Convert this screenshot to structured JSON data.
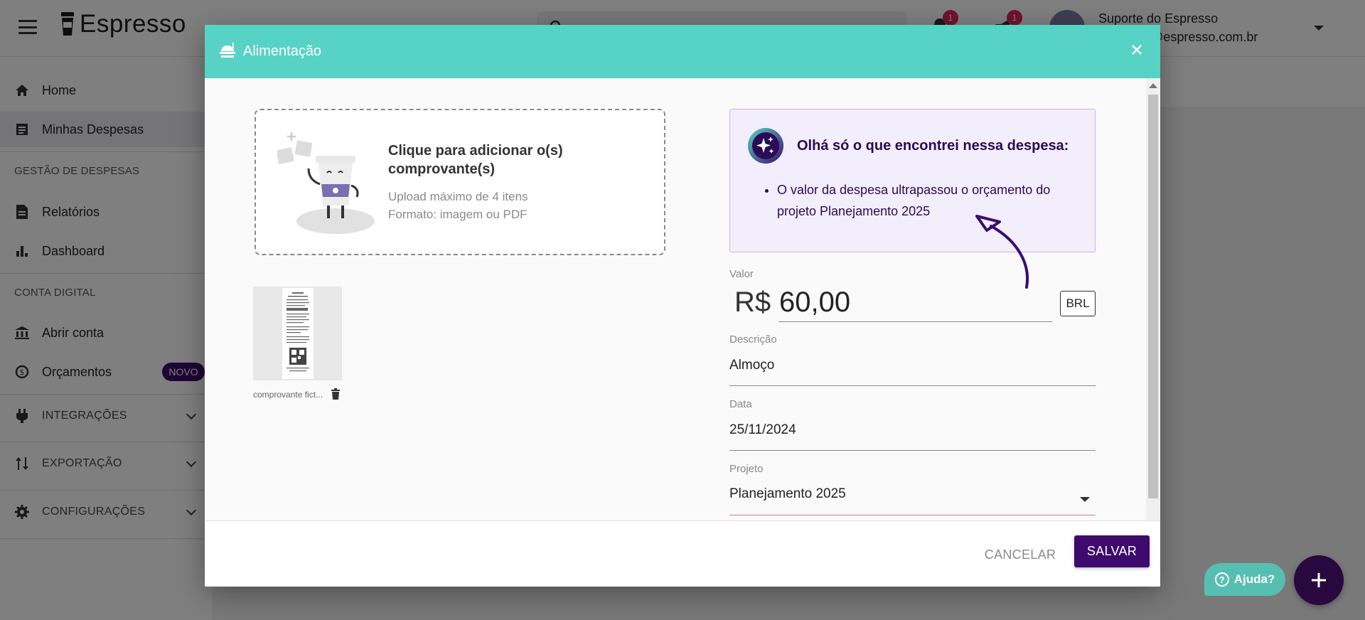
{
  "app": {
    "title": "Espresso"
  },
  "user": {
    "name": "Suporte do Espresso",
    "email": "espresso@espresso.com.br"
  },
  "notifications": [
    {
      "icon": "bell-icon",
      "count": "1"
    },
    {
      "icon": "megaphone-icon",
      "count": "1"
    }
  ],
  "sidebar": {
    "items": [
      {
        "label": "Home",
        "icon": "home-icon"
      },
      {
        "label": "Minhas Despesas",
        "icon": "receipt-list-icon",
        "active": true
      },
      {
        "label": "Relatórios",
        "icon": "document-icon"
      },
      {
        "label": "Dashboard",
        "icon": "bar-chart-icon"
      },
      {
        "label": "Abrir conta",
        "icon": "bank-icon"
      },
      {
        "label": "Orçamentos",
        "icon": "budget-cycle-icon",
        "badge": "NOVO"
      },
      {
        "label": "INTEGRAÇÕES",
        "icon": "plug-icon"
      },
      {
        "label": "EXPORTAÇÃO",
        "icon": "swap-vertical-icon"
      },
      {
        "label": "CONFIGURAÇÕES",
        "icon": "gear-icon"
      }
    ],
    "sections": [
      "GESTÃO DE DESPESAS",
      "CONTA DIGITAL"
    ]
  },
  "modal": {
    "title": "Alimentação",
    "upload": {
      "title": "Clique para adicionar o(s) comprovante(s)",
      "max_items": "Upload máximo de 4 itens",
      "format": "Formato: imagem ou PDF"
    },
    "attachment": {
      "filename": "comprovante fict..."
    },
    "ai_insight": {
      "title": "Olhá só o que encontrei nessa despesa:",
      "items": [
        "O valor da despesa ultrapassou o orçamento do projeto Planejamento 2025"
      ]
    },
    "fields": {
      "valor": {
        "label": "Valor",
        "prefix": "R$",
        "value": "60,00",
        "currency": "BRL"
      },
      "descricao": {
        "label": "Descrição",
        "value": "Almoço"
      },
      "data": {
        "label": "Data",
        "value": "25/11/2024"
      },
      "projeto": {
        "label": "Projeto",
        "value": "Planejamento 2025"
      }
    },
    "buttons": {
      "cancel": "CANCELAR",
      "save": "SALVAR"
    }
  },
  "help": {
    "label": "Ajuda?"
  },
  "colors": {
    "header": "#56d3c4",
    "primary": "#3d0b6d",
    "accent_badge": "#e0245e",
    "ai_card_bg": "#f3eefb",
    "projeto_underline": "#d9798e"
  }
}
